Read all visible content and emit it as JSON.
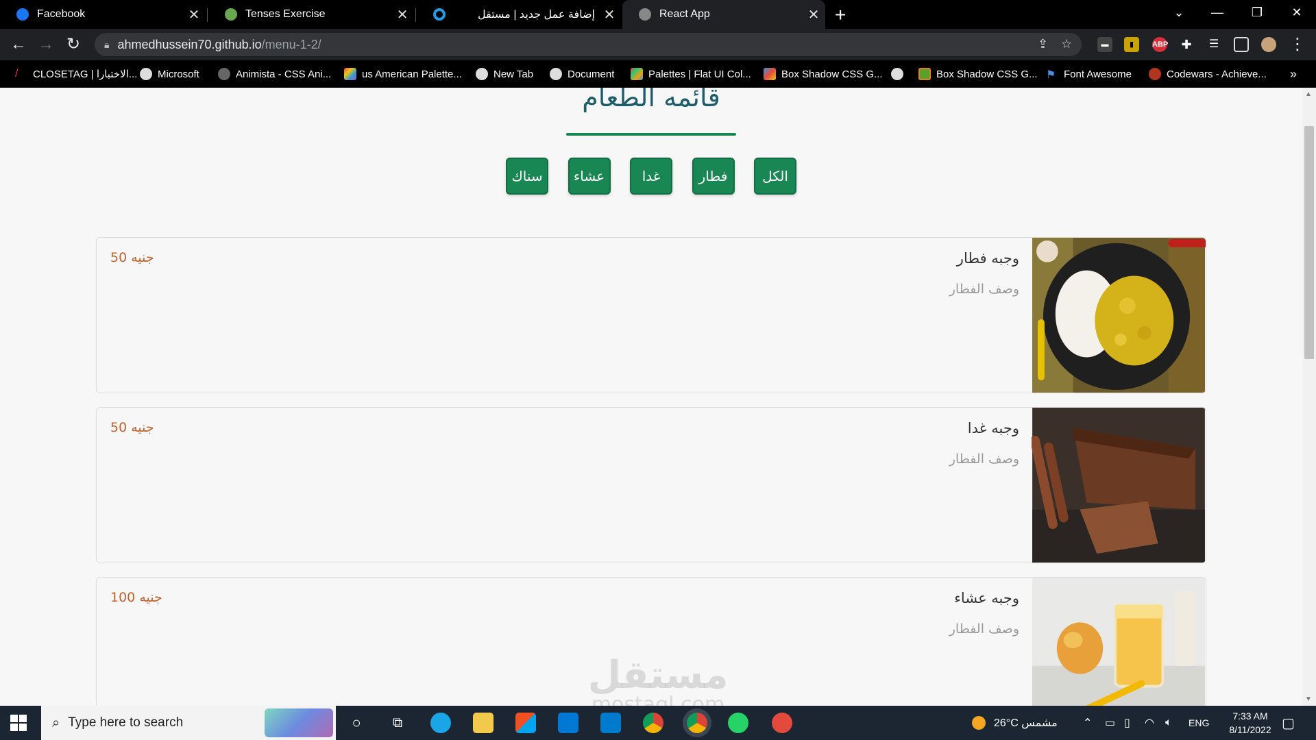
{
  "browser": {
    "tabs": [
      {
        "title": "Facebook",
        "color": "#1877f2"
      },
      {
        "title": "Tenses Exercise",
        "color": "#6aa84f"
      },
      {
        "title": "إضافة عمل جديد | مستقل",
        "color": "#1e9de6"
      },
      {
        "title": "React App",
        "color": "#888888"
      }
    ],
    "url_host": "ahmedhussein70.github.io",
    "url_path": "/menu-1-2/",
    "bookmarks": [
      "CLOSETAG | الاختبارا...",
      "Microsoft",
      "Animista - CSS Ani...",
      "us American Palette...",
      "New Tab",
      "Document",
      "Palettes | Flat UI Col...",
      "Box Shadow CSS G...",
      "",
      "Box Shadow CSS G...",
      "Font Awesome",
      "Codewars - Achieve..."
    ],
    "bookmarks_more": "»"
  },
  "page": {
    "title": "قائمه الطعام",
    "filters": [
      "الكل",
      "فطار",
      "غدا",
      "عشاء",
      "سناك"
    ],
    "items": [
      {
        "name": "وجبه فطار",
        "description": "وصف الفطار",
        "price": "50 جنيه",
        "image": "curry-rice"
      },
      {
        "name": "وجبه غدا",
        "description": "وصف الفطار",
        "price": "50 جنيه",
        "image": "chocolate-cake"
      },
      {
        "name": "وجبه عشاء",
        "description": "وصف الفطار",
        "price": "100 جنيه",
        "image": "mango-juice"
      }
    ],
    "watermark": {
      "arabic": "مستقل",
      "latin": "mostaql.com"
    }
  },
  "taskbar": {
    "search_placeholder": "Type here to search",
    "weather": "26°C  مشمس",
    "lang": "ENG",
    "time": "7:33 AM",
    "date": "8/11/2022"
  },
  "colors": {
    "accent": "#198754",
    "title": "#1f5d6b",
    "price": "#c0622d"
  }
}
